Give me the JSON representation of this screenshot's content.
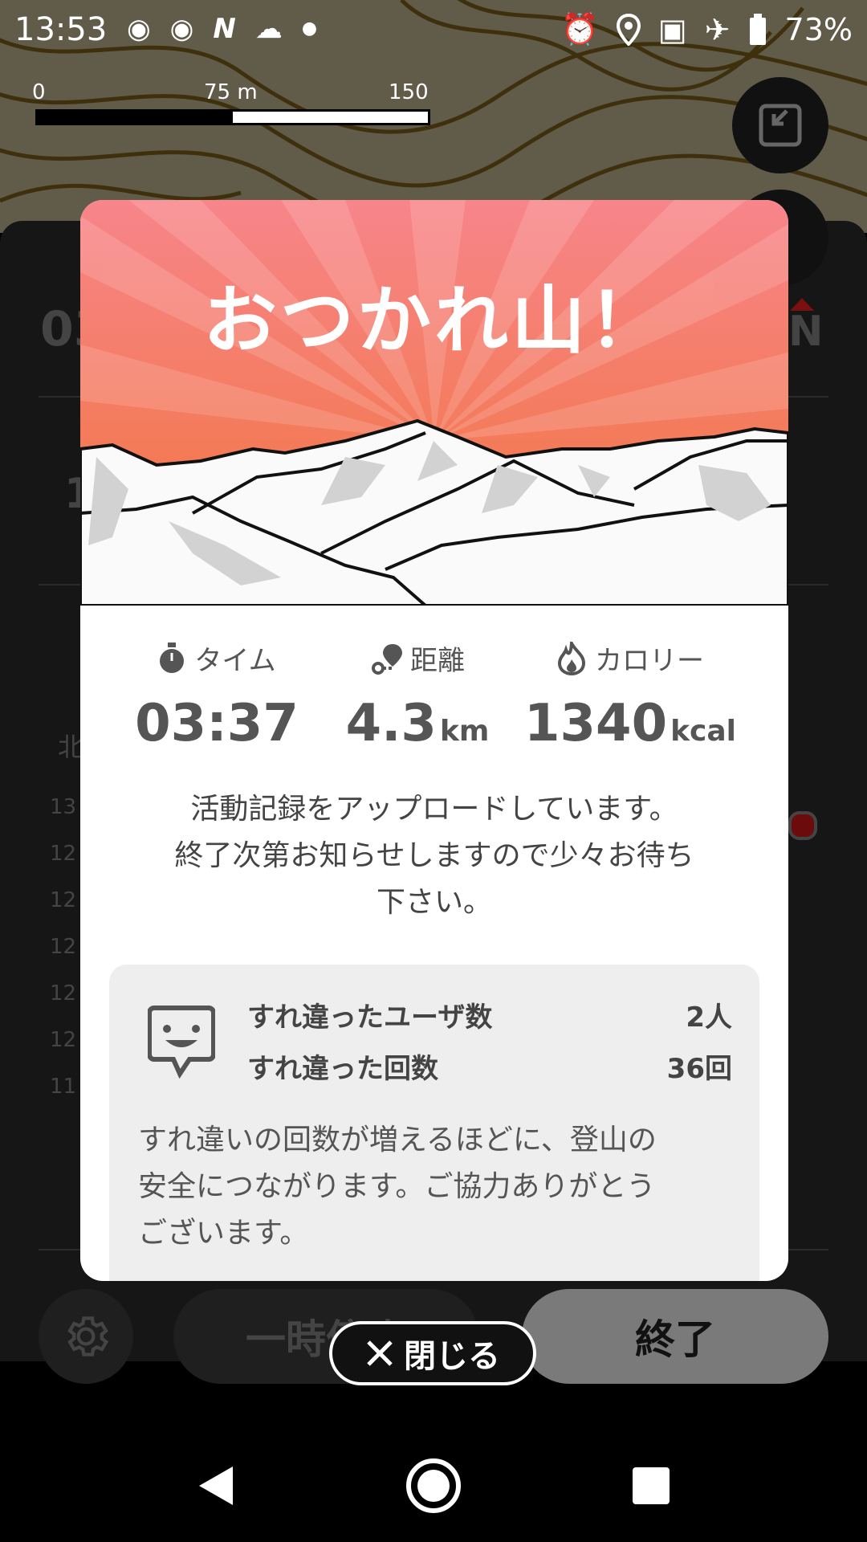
{
  "status_bar": {
    "time": "13:53",
    "battery": "73%",
    "left_icons": [
      "app-icon",
      "app-icon",
      "n-icon",
      "weather-icon",
      "dot-icon"
    ],
    "right_icons": [
      "alarm-icon",
      "location-icon",
      "data-saver-icon",
      "airplane-icon",
      "battery-icon"
    ]
  },
  "map": {
    "scale": {
      "start": "0",
      "mid": "75 m",
      "end": "150 m"
    }
  },
  "background": {
    "time_fragment": "03",
    "compass": "N",
    "row_fragment": "1",
    "north_label": "北",
    "altitudes": [
      "13",
      "12",
      "12",
      "12",
      "12",
      "12",
      "11"
    ]
  },
  "modal": {
    "title": "おつかれ山！",
    "stats": {
      "time": {
        "label": "タイム",
        "value": "03:37"
      },
      "distance": {
        "label": "距離",
        "value": "4.3",
        "unit": "km"
      },
      "calories": {
        "label": "カロリー",
        "value": "1340",
        "unit": "kcal"
      }
    },
    "upload_message": [
      "活動記録をアップロードしています。",
      "終了次第お知らせしますので少々お待ち",
      "下さい。"
    ],
    "passing": {
      "users_label": "すれ違ったユーザ数",
      "users_value": "2人",
      "count_label": "すれ違った回数",
      "count_value": "36回",
      "description": [
        "すれ違いの回数が増えるほどに、登山の",
        "安全につながります。ご協力ありがとう",
        "ございます。"
      ]
    }
  },
  "controls": {
    "pause_label": "一時停止",
    "end_label": "終了",
    "close_label": "閉じる"
  },
  "colors": {
    "hero_top": "#f7858a",
    "hero_bottom": "#f2743a",
    "text_gray": "#555555"
  }
}
